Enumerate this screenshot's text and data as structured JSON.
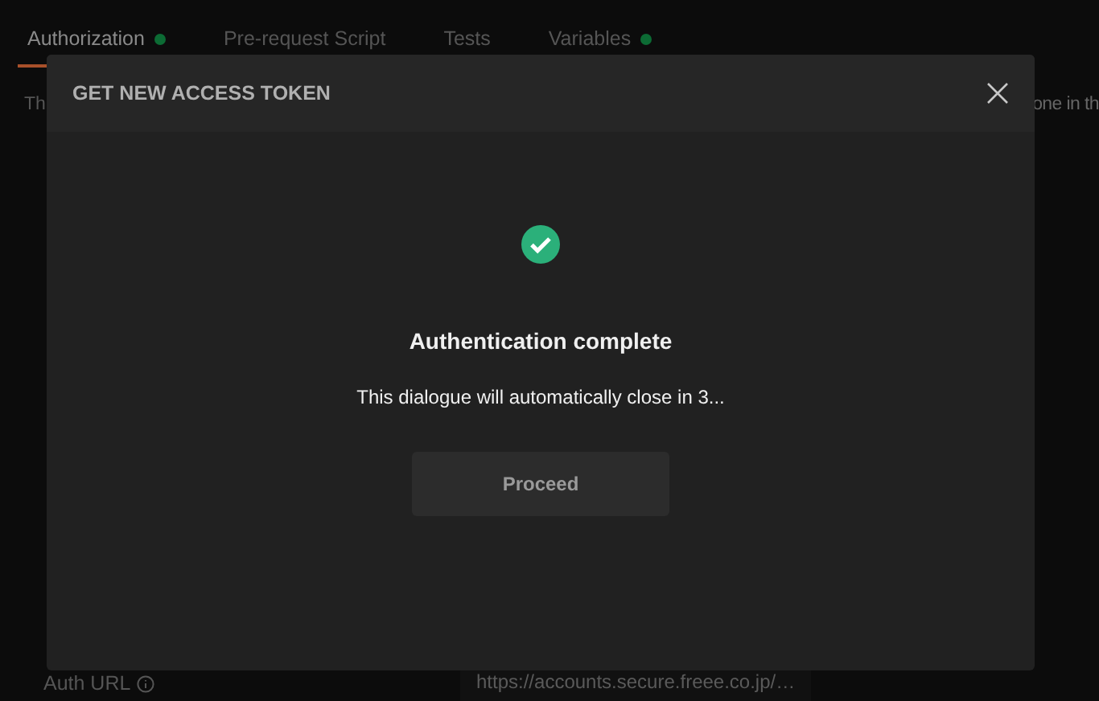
{
  "tabs": [
    {
      "label": "Authorization",
      "selected": true,
      "dot": true
    },
    {
      "label": "Pre-request Script",
      "selected": false,
      "dot": false
    },
    {
      "label": "Tests",
      "selected": false,
      "dot": false
    },
    {
      "label": "Variables",
      "selected": false,
      "dot": true
    }
  ],
  "description": {
    "visible_start": "Th",
    "visible_end": "one in th"
  },
  "auth_url": {
    "label": "Auth URL",
    "value": "https://accounts.secure.freee.co.jp/…"
  },
  "dialog": {
    "title": "GET NEW ACCESS TOKEN",
    "heading": "Authentication complete",
    "message": "This dialogue will automatically close in 3...",
    "button": "Proceed"
  }
}
